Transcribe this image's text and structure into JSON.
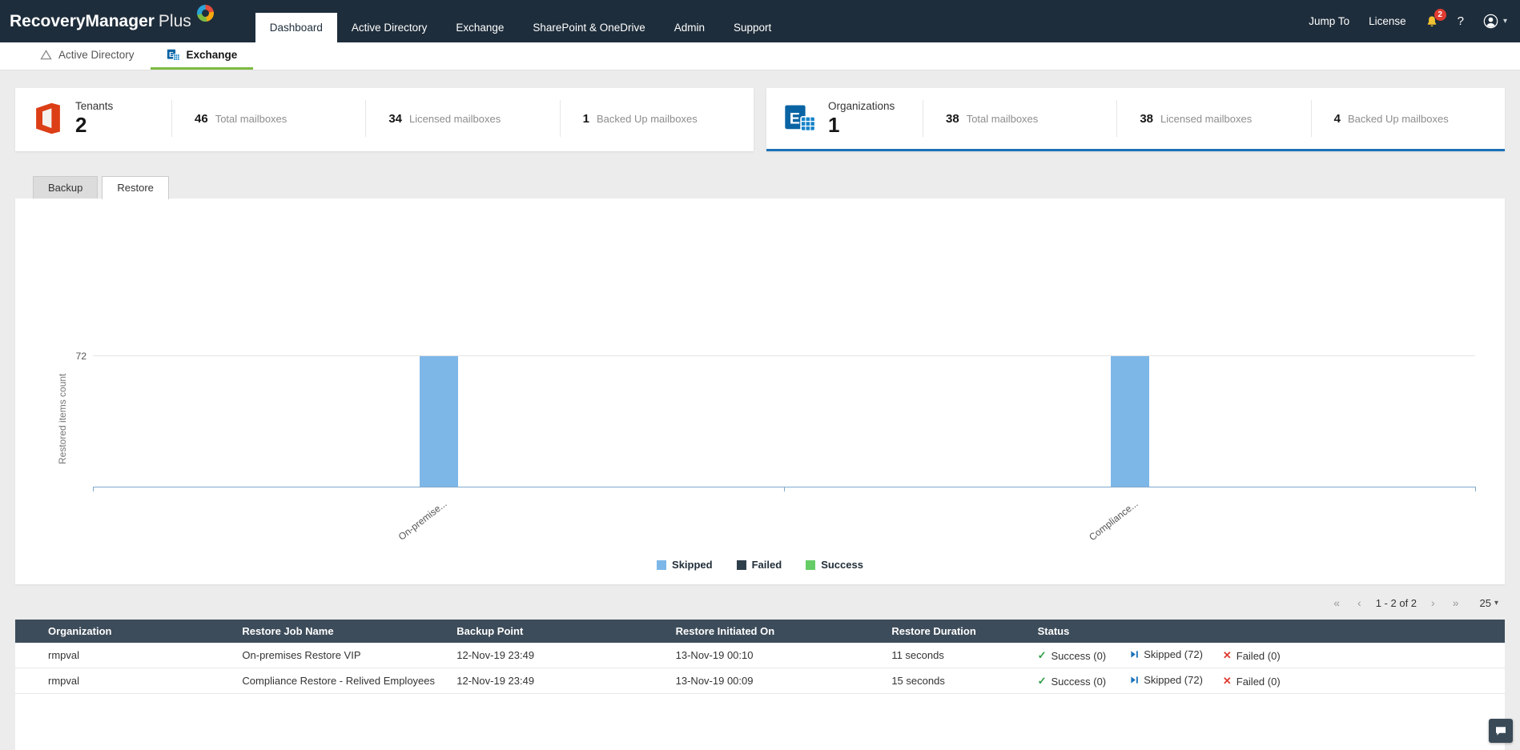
{
  "app": {
    "brand": "RecoveryManager",
    "brand_suffix": "Plus"
  },
  "topnav": {
    "items": [
      {
        "label": "Dashboard",
        "active": true
      },
      {
        "label": "Active Directory",
        "active": false
      },
      {
        "label": "Exchange",
        "active": false
      },
      {
        "label": "SharePoint & OneDrive",
        "active": false
      },
      {
        "label": "Admin",
        "active": false
      },
      {
        "label": "Support",
        "active": false
      }
    ],
    "right": {
      "jump_to": "Jump To",
      "license": "License",
      "notification_count": "2",
      "help": "?",
      "user_caret": "▾"
    }
  },
  "subnav": {
    "items": [
      {
        "label": "Active Directory",
        "active": false
      },
      {
        "label": "Exchange",
        "active": true
      }
    ]
  },
  "cards": [
    {
      "title": "Tenants",
      "count": "2",
      "selected": false,
      "stats": [
        {
          "value": "46",
          "label": "Total mailboxes"
        },
        {
          "value": "34",
          "label": "Licensed mailboxes"
        },
        {
          "value": "1",
          "label": "Backed Up mailboxes"
        }
      ]
    },
    {
      "title": "Organizations",
      "count": "1",
      "selected": true,
      "stats": [
        {
          "value": "38",
          "label": "Total mailboxes"
        },
        {
          "value": "38",
          "label": "Licensed mailboxes"
        },
        {
          "value": "4",
          "label": "Backed Up mailboxes"
        }
      ]
    }
  ],
  "panel": {
    "tabs": [
      {
        "label": "Backup",
        "active": false
      },
      {
        "label": "Restore",
        "active": true
      }
    ]
  },
  "chart_data": {
    "type": "bar",
    "title": "",
    "xlabel": "",
    "ylabel": "Restored items count",
    "ytick": "72",
    "ylim": [
      0,
      146
    ],
    "grid": "single-horizontal-line-at-72",
    "legend_position": "bottom-center",
    "categories": [
      "On-premise...",
      "Compliance..."
    ],
    "series": [
      {
        "name": "Skipped",
        "color": "#7db7e8",
        "values": [
          72,
          72
        ]
      },
      {
        "name": "Failed",
        "color": "#2e3e4b",
        "values": [
          0,
          0
        ]
      },
      {
        "name": "Success",
        "color": "#66cc66",
        "values": [
          0,
          0
        ]
      }
    ]
  },
  "pagination": {
    "first_label": "«",
    "prev_label": "‹",
    "range_label": "1 - 2 of 2",
    "next_label": "›",
    "last_label": "»",
    "page_size": "25",
    "caret": "▾"
  },
  "table": {
    "columns": [
      "Organization",
      "Restore Job Name",
      "Backup Point",
      "Restore Initiated On",
      "Restore Duration",
      "Status"
    ],
    "status_icons": {
      "success": "✓",
      "failed": "✕"
    },
    "rows": [
      {
        "organization": "rmpval",
        "job_name": "On-premises Restore VIP",
        "backup_point": "12-Nov-19 23:49",
        "initiated_on": "13-Nov-19 00:10",
        "duration": "11 seconds",
        "status": {
          "success": "Success (0)",
          "skipped": "Skipped (72)",
          "failed": "Failed (0)"
        }
      },
      {
        "organization": "rmpval",
        "job_name": "Compliance Restore - Relived Employees",
        "backup_point": "12-Nov-19 23:49",
        "initiated_on": "13-Nov-19 00:09",
        "duration": "15 seconds",
        "status": {
          "success": "Success (0)",
          "skipped": "Skipped (72)",
          "failed": "Failed (0)"
        }
      }
    ]
  },
  "colors": {
    "topbar": "#1e2d3b",
    "accent_green": "#7cbb42",
    "card_selected_border": "#1c72b8",
    "bar": "#7db7e8",
    "legend_failed": "#2e3e4b",
    "legend_success": "#66cc66",
    "table_header": "#3d4c5a",
    "success": "#2e9e44",
    "failed": "#e03c31",
    "skipped_icon": "#1c72b8"
  }
}
